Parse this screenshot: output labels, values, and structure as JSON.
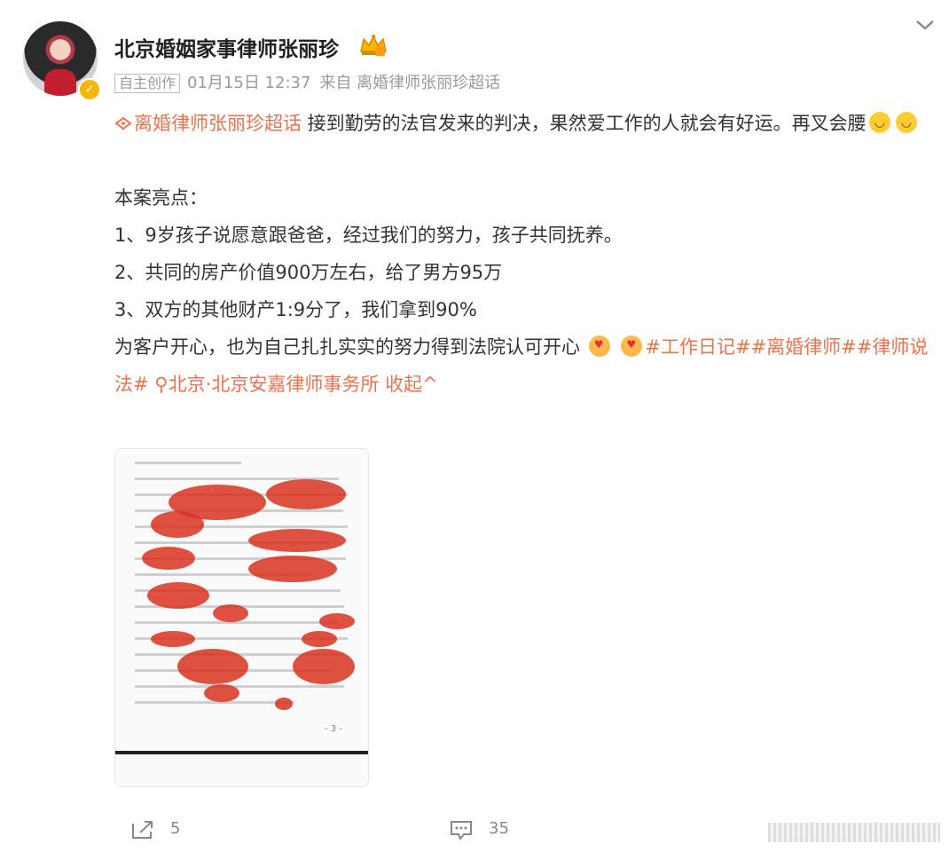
{
  "author": {
    "name": "北京婚姻家事律师张丽珍",
    "badge_icon": "crown-icon",
    "verified_icon": "verified-badge-icon"
  },
  "meta": {
    "tag": "自主创作",
    "time": "01月15日 12:37",
    "source": "来自 离婚律师张丽珍超话"
  },
  "post": {
    "topic_link": "离婚律师张丽珍超话",
    "line1_rest": " 接到勤劳的法官发来的判决，果然爱工作的人就会有好运。再叉会腰",
    "heading": "本案亮点：",
    "items": [
      "1、9岁孩子说愿意跟爸爸，经过我们的努力，孩子共同抚养。",
      "2、共同的房产价值900万左右，给了男方95万",
      "3、双方的其他财产1:9分了，我们拿到90%"
    ],
    "closing": "为客户开心，也为自己扎扎实实的努力得到法院认可开心",
    "hashtag1": "#工作日记#",
    "hashtag2": "#离婚律师#",
    "hashtag3": "#律师说法#",
    "location": "北京·北京安嘉律师事务所",
    "collapse": "收起"
  },
  "image": {
    "page_number": "- 3 -"
  },
  "footer": {
    "shares": "5",
    "comments": "35"
  },
  "colors": {
    "link": "#eb7350",
    "text": "#333333",
    "meta": "#999999"
  }
}
